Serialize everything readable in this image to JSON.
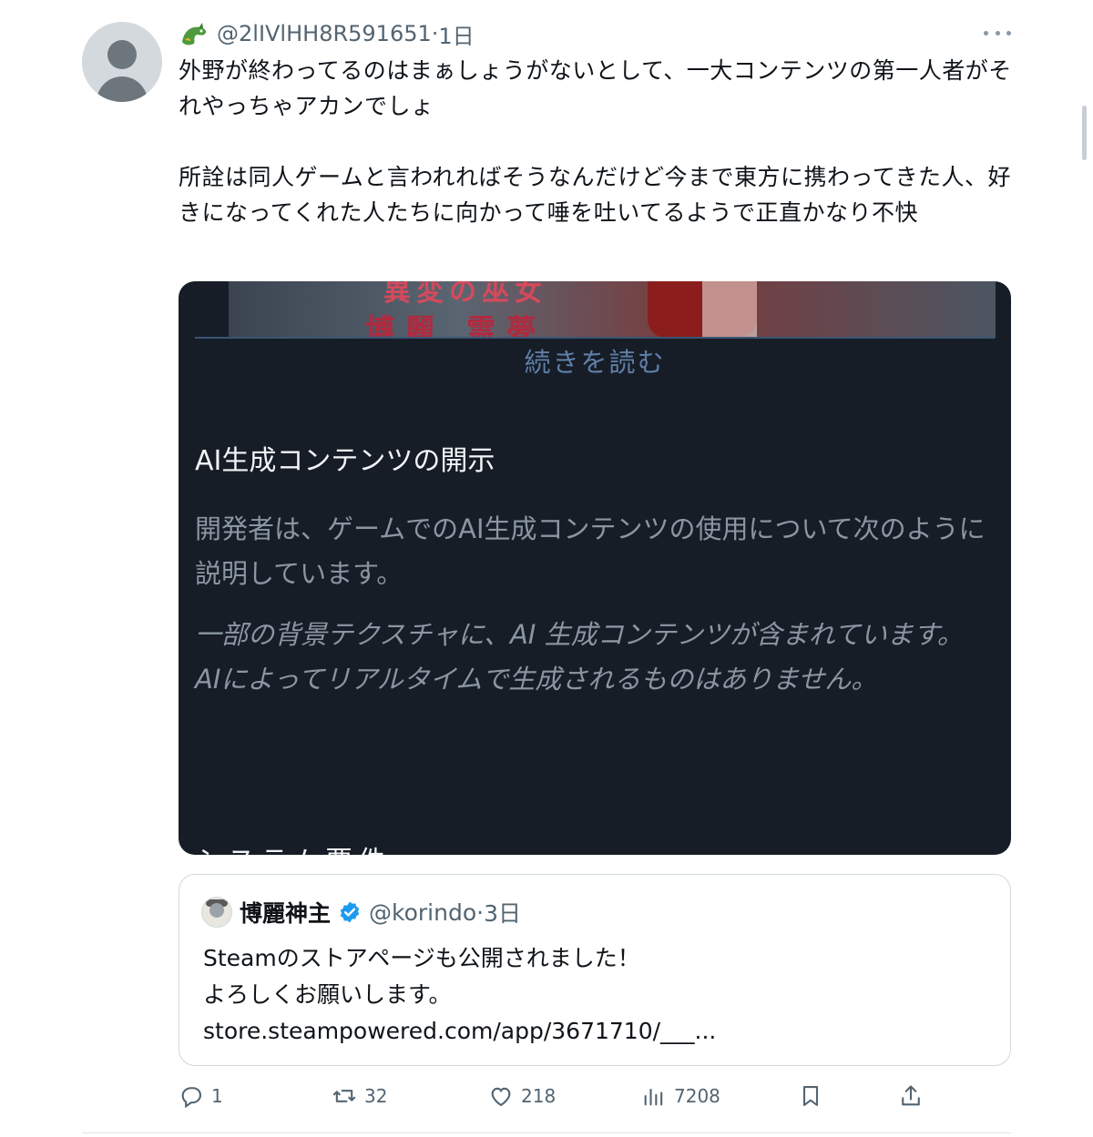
{
  "tweet": {
    "handle": "@2lIVlHH8R591651",
    "separator": "·",
    "time": "1日",
    "text": "外野が終わってるのはまぁしょうがないとして、一大コンテンツの第一人者がそれやっちゃアカンでしょ\n\n所詮は同人ゲームと言われればそうなんだけど今まで東方に携わってきた人、好きになってくれた人たちに向かって唾を吐いてるようで正直かなり不快"
  },
  "media": {
    "banner_fragment_top": "異変の巫女",
    "banner_fragment_bottom": "博麗 霊夢",
    "read_more": "続きを読む",
    "heading": "AI生成コンテンツの開示",
    "paragraph": "開発者は、ゲームでのAI生成コンテンツの使用について次のように説明しています。",
    "italic_text": "一部の背景テクスチャに、AI 生成コンテンツが含まれています。\nAIによってリアルタイムで生成されるものはありません。",
    "cut_heading": "システム要件"
  },
  "quote": {
    "name": "博麗神主",
    "handle": "@korindo",
    "separator": "·",
    "time": "3日",
    "text": "Steamのストアページも公開されました！\nよろしくお願いします。\nstore.steampowered.com/app/3671710/___..."
  },
  "actions": {
    "replies": "1",
    "retweets": "32",
    "likes": "218",
    "views": "7208"
  },
  "colors": {
    "text": "#0f1419",
    "secondary": "#536471",
    "verified": "#1d9bf0",
    "media_bg": "#161d27"
  }
}
